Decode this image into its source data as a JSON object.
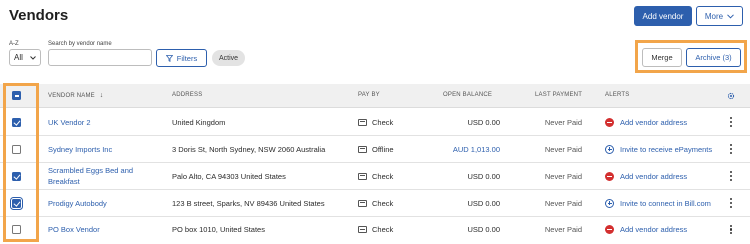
{
  "page": {
    "title": "Vendors"
  },
  "header": {
    "add_vendor_label": "Add vendor",
    "more_label": "More"
  },
  "filters": {
    "az_label": "A-Z",
    "az_value": "All",
    "search_label": "Search by vendor name",
    "search_value": "",
    "search_placeholder": "",
    "filters_label": "Filters",
    "active_chip": "Active"
  },
  "bulk_actions": {
    "merge_label": "Merge",
    "archive_label": "Archive (3)"
  },
  "table": {
    "columns": [
      "VENDOR NAME",
      "ADDRESS",
      "PAY BY",
      "OPEN BALANCE",
      "LAST PAYMENT",
      "ALERTS"
    ],
    "sort_indicator": "↓",
    "header_checkbox_state": "indeterminate",
    "rows": [
      {
        "checked": true,
        "vendor": "UK Vendor 2",
        "address": "United Kingdom",
        "pay_by": "Check",
        "balance": "USD 0.00",
        "balance_link": false,
        "last_payment": "Never Paid",
        "alert": "Add vendor address",
        "alert_type": "error"
      },
      {
        "checked": false,
        "vendor": "Sydney Imports Inc",
        "address": "3 Doris St, North Sydney, NSW 2060 Australia",
        "pay_by": "Offline",
        "balance": "AUD 1,013.00",
        "balance_link": true,
        "last_payment": "Never Paid",
        "alert": "Invite to receive ePayments",
        "alert_type": "invite"
      },
      {
        "checked": true,
        "vendor": "Scrambled Eggs Bed and Breakfast",
        "address": "Palo Alto, CA 94303 United States",
        "pay_by": "Check",
        "balance": "USD 0.00",
        "balance_link": false,
        "last_payment": "Never Paid",
        "alert": "Add vendor address",
        "alert_type": "error"
      },
      {
        "checked": true,
        "vendor": "Prodigy Autobody",
        "address": "123 B street, Sparks, NV 89436 United States",
        "pay_by": "Check",
        "balance": "USD 0.00",
        "balance_link": false,
        "last_payment": "Never Paid",
        "alert": "Invite to connect in Bill.com",
        "alert_type": "invite"
      },
      {
        "checked": false,
        "vendor": "PO Box Vendor",
        "address": "PO box 1010, United States",
        "pay_by": "Check",
        "balance": "USD 0.00",
        "balance_link": false,
        "last_payment": "Never Paid",
        "alert": "Add vendor address",
        "alert_type": "error"
      }
    ]
  },
  "colors": {
    "accent": "#2d5fad",
    "error": "#d32f2f",
    "highlight": "#f2a54a",
    "header_bg": "#f0f0f0"
  }
}
